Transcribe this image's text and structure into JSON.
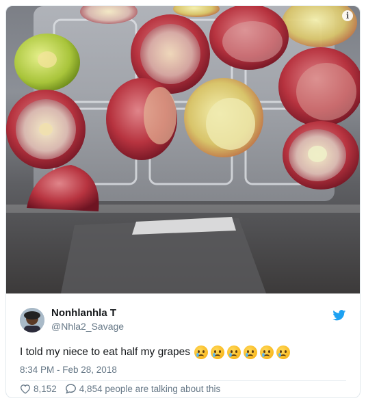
{
  "tweet": {
    "display_name": "Nonhlanhla T",
    "handle": "@Nhla2_Savage",
    "text": "I told my niece  to eat half my grapes",
    "emoji_count": 6,
    "emoji_name": "crying-face",
    "timestamp": "8:34 PM - Feb 28, 2018",
    "like_count": "8,152",
    "talking_text": "4,854 people are talking about this"
  },
  "icons": {
    "info": "i",
    "bird": "twitter-bird-icon",
    "heart": "heart-icon",
    "reply": "speech-bubble-icon"
  },
  "colors": {
    "brand": "#1da1f2",
    "text": "#14171a",
    "muted": "#657786",
    "border": "#e1e8ed"
  }
}
